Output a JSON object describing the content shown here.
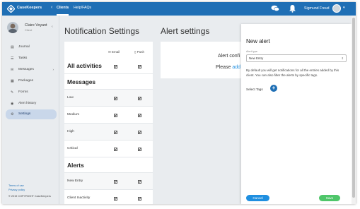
{
  "topbar": {
    "brand": "CaseKeepers",
    "collapse_glyph": "‹",
    "nav": [
      {
        "label": "Clients"
      },
      {
        "label": "Help/FAQs"
      }
    ],
    "user_name": "Sigmund Freud",
    "icons": [
      "chat-icon",
      "bell-icon",
      "caret-down-icon"
    ]
  },
  "sidebar": {
    "client_name": "Claire Voyant",
    "client_role": "Client",
    "items": [
      {
        "label": "Journal",
        "icon": "journal-icon",
        "glyph": "▤"
      },
      {
        "label": "Tasks",
        "icon": "tasks-icon",
        "glyph": "☰"
      },
      {
        "label": "Messages",
        "icon": "messages-icon",
        "glyph": "✉",
        "chevron": "›"
      },
      {
        "label": "Packages",
        "icon": "packages-icon",
        "glyph": "▦"
      },
      {
        "label": "Forms",
        "icon": "forms-icon",
        "glyph": "✎"
      },
      {
        "label": "Alert history",
        "icon": "alert-history-icon",
        "glyph": "◉"
      },
      {
        "label": "Settings",
        "icon": "settings-icon",
        "glyph": "⚙",
        "active": true
      }
    ],
    "terms": "Terms of use",
    "privacy": "Privacy policy",
    "copyright": "© 2019 COPYRIGHT CaseKeepers"
  },
  "main": {
    "title": "Notification Settings",
    "col_email": "✉ Email",
    "col_push": "▯ Push",
    "rows": [
      {
        "label": "All activities",
        "section": true,
        "email": true,
        "push": true
      },
      {
        "label": "Messages",
        "section": true,
        "header_only": true
      },
      {
        "label": "Low",
        "email": true,
        "push": true
      },
      {
        "label": "Medium",
        "email": true,
        "push": true
      },
      {
        "label": "High",
        "email": true,
        "push": true
      },
      {
        "label": "Critical",
        "email": true,
        "push": true
      },
      {
        "label": "Alerts",
        "section": true,
        "header_only": true
      },
      {
        "label": "New Entry",
        "email": true,
        "push": true
      },
      {
        "label": "Client Inactivity",
        "email": true,
        "push": true
      }
    ]
  },
  "alert_settings": {
    "title": "Alert settings",
    "msg1": "Alert confi",
    "msg2_prefix": "Please ",
    "msg2_link": "add"
  },
  "modal": {
    "title": "New alert",
    "type_label": "Alert type",
    "type_value": "New Entry",
    "description": "By default you will get notifications for all the entries added by this client. You can also filter the alerts by specific tags.",
    "tags_label": "Select Tags",
    "plus": "+",
    "cancel": "Cancel",
    "save": "Save"
  },
  "check_glyph": "✔"
}
